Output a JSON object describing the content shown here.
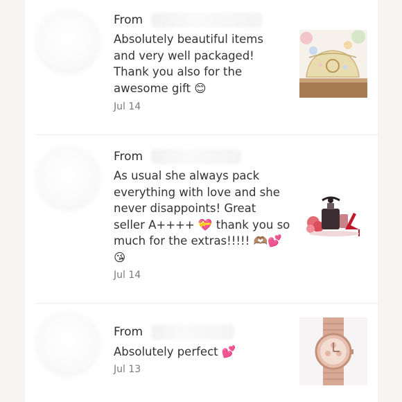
{
  "reviews": [
    {
      "from_label": "From",
      "text": "Absolutely beautiful items\nand very well packaged!\nThank you also for the\nawesome gift 😊",
      "date": "Jul 14",
      "image_icon": "makeup-bag-photo"
    },
    {
      "from_label": "From",
      "text": "As usual she always pack\neverything with love and she\nnever disappoints! Great\nseller A++++ 💝 thank you so\nmuch for the extras!!!!! 🫶🏽💕\n😘",
      "date": "Jul 14",
      "image_icon": "perfume-heels-illustration"
    },
    {
      "from_label": "From",
      "text": "Absolutely perfect 💕",
      "date": "Jul 13",
      "image_icon": "rose-gold-watch-photo"
    }
  ],
  "colors": {
    "background": "#f7f4f4",
    "panel": "#ffffff",
    "divider": "#ececec",
    "text": "#333333",
    "date": "#7a7a7a"
  }
}
